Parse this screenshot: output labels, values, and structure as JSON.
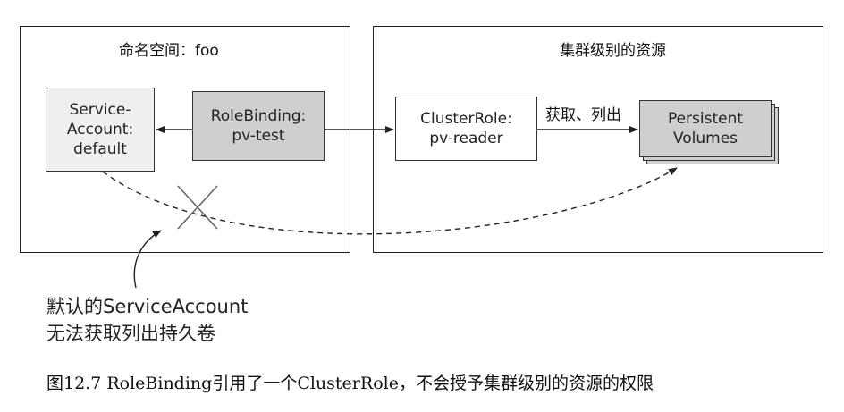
{
  "regions": {
    "namespace": {
      "title": "命名空间：foo"
    },
    "cluster": {
      "title": "集群级别的资源"
    }
  },
  "nodes": {
    "service_account": {
      "label": "Service-\nAccount:\ndefault"
    },
    "role_binding": {
      "label": "RoleBinding:\npv-test"
    },
    "cluster_role": {
      "label": "ClusterRole:\npv-reader"
    },
    "persistent_volumes": {
      "label": "Persistent\nVolumes"
    }
  },
  "edges": {
    "get_list_label": "获取、列出"
  },
  "annotation": {
    "note": "默认的ServiceAccount\n无法获取列出持久卷"
  },
  "caption": "图12.7 RoleBinding引用了一个ClusterRole，不会授予集群级别的资源的权限",
  "colors": {
    "line": "#222222",
    "node_light": "#efefef",
    "node_dark": "#cfcfcf"
  }
}
